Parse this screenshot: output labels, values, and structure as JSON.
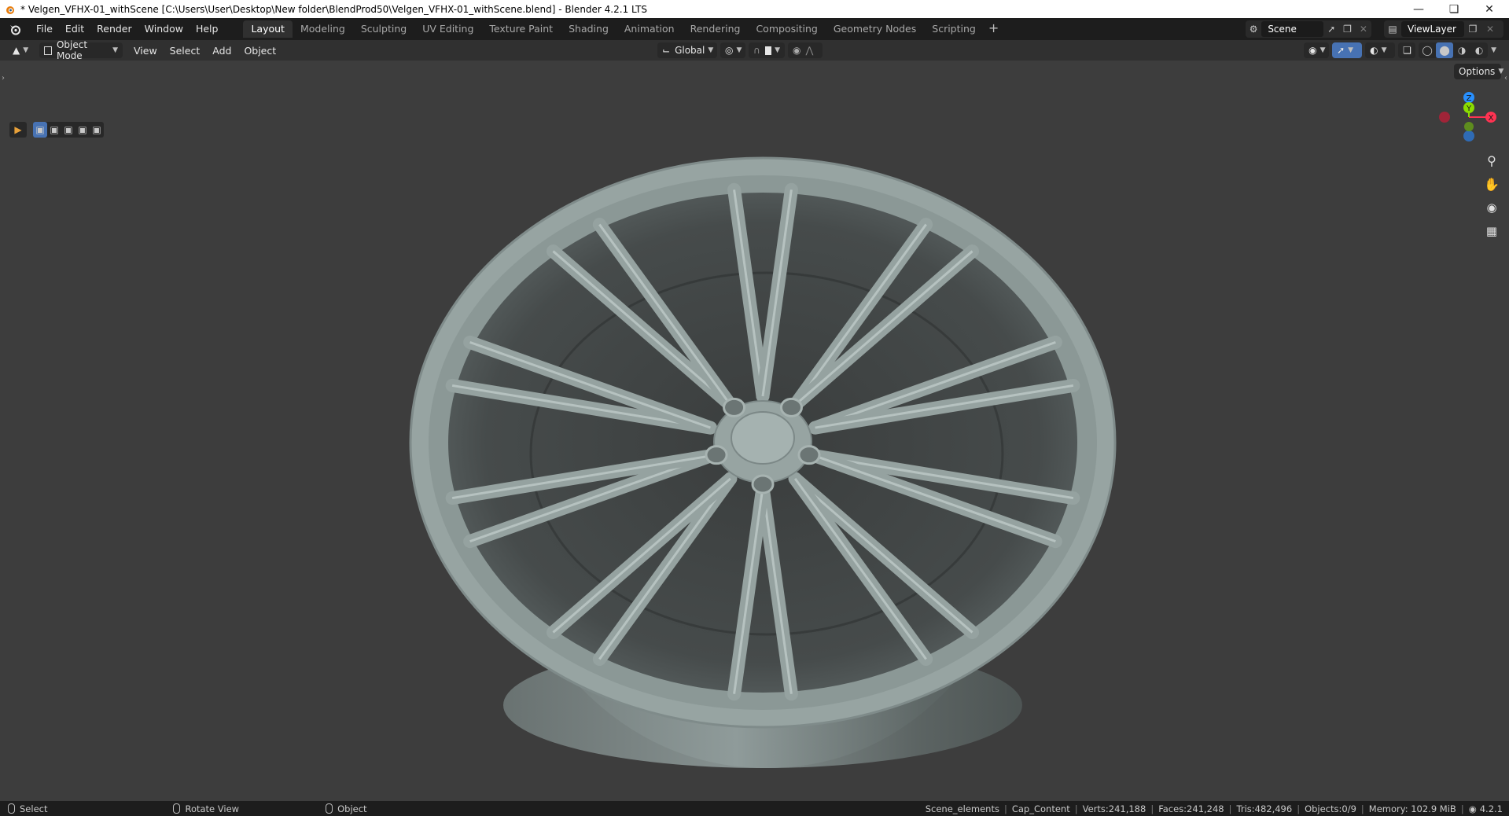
{
  "window": {
    "title": "* Velgen_VFHX-01_withScene [C:\\Users\\User\\Desktop\\New folder\\BlendProd50\\Velgen_VFHX-01_withScene.blend] - Blender 4.2.1 LTS",
    "controls": [
      "minimize-icon",
      "restore-icon",
      "close-icon"
    ]
  },
  "menu": {
    "items": [
      "File",
      "Edit",
      "Render",
      "Window",
      "Help"
    ]
  },
  "workspaces": {
    "active": "Layout",
    "tabs": [
      "Layout",
      "Modeling",
      "Sculpting",
      "UV Editing",
      "Texture Paint",
      "Shading",
      "Animation",
      "Rendering",
      "Compositing",
      "Geometry Nodes",
      "Scripting"
    ],
    "add_label": "+"
  },
  "scene": {
    "name": "Scene"
  },
  "view_layer": {
    "name": "ViewLayer"
  },
  "viewport_header": {
    "mode": "Object Mode",
    "menus": [
      "View",
      "Select",
      "Add",
      "Object"
    ],
    "transform_orientation": "Global",
    "options_label": "Options"
  },
  "navigation_gizmo": {
    "axes": {
      "x": "X",
      "y": "Y",
      "z": "Z"
    },
    "colors": {
      "x": "#ff3352",
      "y": "#8bdc00",
      "z": "#2890ff"
    },
    "tools": [
      "zoom-icon",
      "pan-hand-icon",
      "camera-icon",
      "ortho-grid-icon"
    ]
  },
  "statusbar": {
    "hints": [
      {
        "label": "Select",
        "icon": "mouse-left-icon"
      },
      {
        "label": "Rotate View",
        "icon": "mouse-middle-icon"
      },
      {
        "label": "Object",
        "icon": "mouse-right-icon"
      }
    ],
    "info": {
      "collection": "Scene_elements",
      "object": "Cap_Content",
      "verts": "Verts:241,188",
      "faces": "Faces:241,248",
      "tris": "Tris:482,496",
      "objects": "Objects:0/9",
      "memory": "Memory: 102.9 MiB",
      "version": "4.2.1"
    }
  },
  "colors": {
    "titlebar_bg": "#ffffff",
    "topbar_bg": "#1d1d1d",
    "header_bg": "#303030",
    "viewport_bg": "#3d3d3d",
    "active_button": "#4772b3",
    "model_color": "#95a3a1"
  }
}
